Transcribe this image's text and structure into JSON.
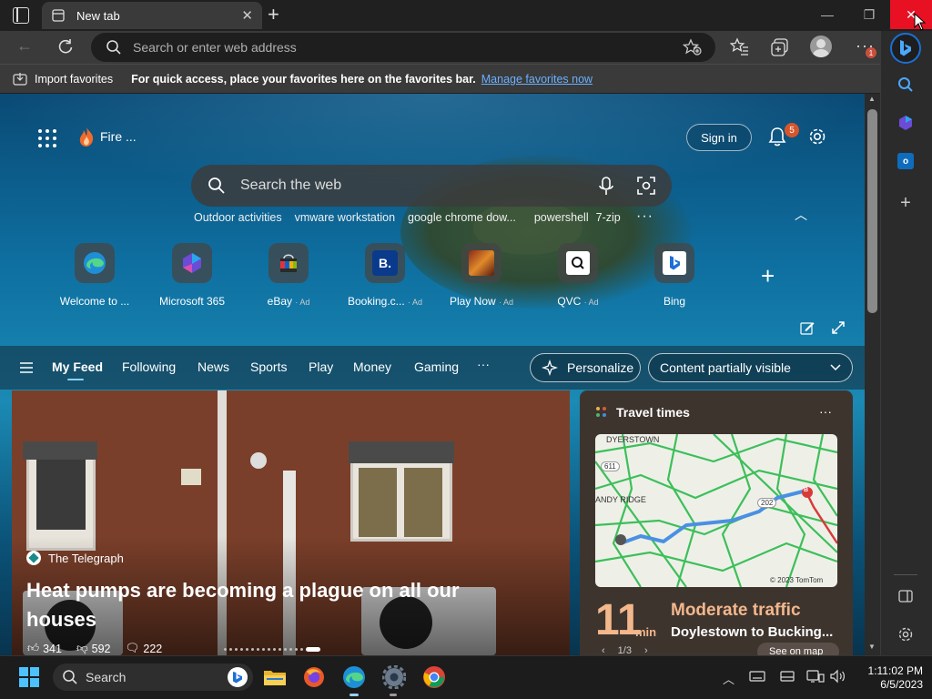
{
  "browser": {
    "tab_title": "New tab",
    "address_placeholder": "Search or enter web address",
    "profile_badge": "1",
    "colors": {
      "chrome": "#202020",
      "toolbar": "#3a3a3a",
      "close_hover": "#e81123",
      "link": "#6ab0ff"
    }
  },
  "favorites_bar": {
    "import_label": "Import favorites",
    "message": "For quick access, place your favorites here on the favorites bar.",
    "manage_link": "Manage favorites now"
  },
  "newtab": {
    "weather_label": "Fire ...",
    "sign_in": "Sign in",
    "notification_count": "5",
    "search_placeholder": "Search the web",
    "trending": [
      "Outdoor activities",
      "vmware workstation",
      "google chrome dow...",
      "powershell",
      "7-zip"
    ],
    "quick_links": [
      {
        "label": "Welcome to ...",
        "ad": "",
        "icon": "edge-icon"
      },
      {
        "label": "Microsoft 365",
        "ad": "",
        "icon": "m365-icon"
      },
      {
        "label": "eBay",
        "ad": "· Ad",
        "icon": "ebay-icon"
      },
      {
        "label": "Booking.c...",
        "ad": "· Ad",
        "icon": "booking-icon"
      },
      {
        "label": "Play Now",
        "ad": "· Ad",
        "icon": "game-icon"
      },
      {
        "label": "QVC",
        "ad": "· Ad",
        "icon": "qvc-icon"
      },
      {
        "label": "Bing",
        "ad": "",
        "icon": "bing-icon"
      }
    ]
  },
  "feed_nav": {
    "tabs": [
      "My Feed",
      "Following",
      "News",
      "Sports",
      "Play",
      "Money",
      "Gaming"
    ],
    "active": "My Feed",
    "personalize": "Personalize",
    "visibility": "Content partially visible"
  },
  "hero": {
    "source": "The Telegraph",
    "headline": "Heat pumps are becoming a plague on all our houses",
    "likes": "341",
    "dislikes": "592",
    "comments": "222"
  },
  "travel": {
    "title": "Travel times",
    "map_labels": {
      "town1": "DYERSTOWN",
      "town2": "ANDY RIDGE",
      "road1": "611",
      "road2": "202",
      "marker_end": "B",
      "copyright": "© 2023 TomTom"
    },
    "minutes": "11",
    "unit": "min",
    "status": "Moderate traffic",
    "route": "Doylestown to Bucking...",
    "pager": "1/3",
    "see_on_map": "See on map"
  },
  "taskbar": {
    "search_label": "Search",
    "time": "1:11:02 PM",
    "date": "6/5/2023"
  }
}
